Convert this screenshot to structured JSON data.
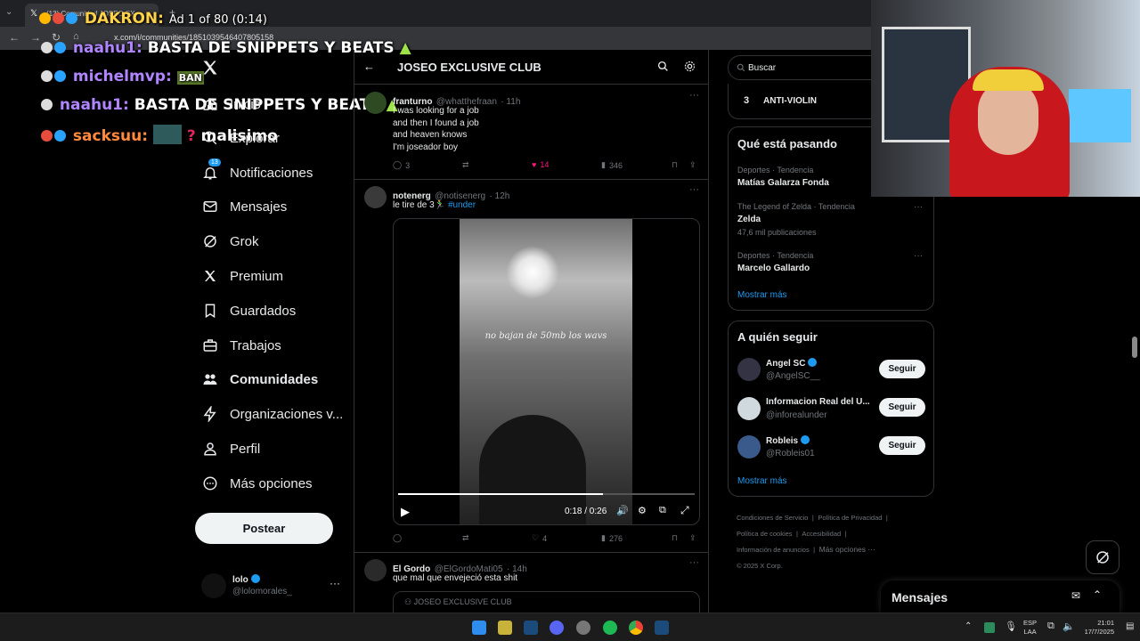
{
  "browser": {
    "tab_title": "(13) Comunidad JOSEO EX...",
    "url": "x.com/i/communities/1851039546407805158",
    "ad_text": "Ad 1 of 80 (0:14)"
  },
  "stream_overlay": {
    "streamer": "DAKRON:",
    "chat": [
      {
        "user": "naahu1:",
        "message": "BASTA DE SNIPPETS Y BEATS"
      },
      {
        "user": "michelmvp:",
        "message": "BAN"
      },
      {
        "user": "naahu1:",
        "message": "BASTA DE SNIPPETS Y BEATS"
      },
      {
        "user": "sacksuu:",
        "message": "malisimo"
      }
    ]
  },
  "nav": {
    "items": [
      {
        "label": "Inicio",
        "icon": "home-icon"
      },
      {
        "label": "Explorar",
        "icon": "search-icon"
      },
      {
        "label": "Notificaciones",
        "icon": "bell-icon",
        "badge": "13"
      },
      {
        "label": "Mensajes",
        "icon": "mail-icon"
      },
      {
        "label": "Grok",
        "icon": "grok-icon"
      },
      {
        "label": "Premium",
        "icon": "x-logo-icon"
      },
      {
        "label": "Guardados",
        "icon": "bookmark-icon"
      },
      {
        "label": "Trabajos",
        "icon": "briefcase-icon"
      },
      {
        "label": "Comunidades",
        "icon": "people-icon"
      },
      {
        "label": "Organizaciones v...",
        "icon": "bolt-icon"
      },
      {
        "label": "Perfil",
        "icon": "person-icon"
      },
      {
        "label": "Más opciones",
        "icon": "more-circle-icon"
      }
    ],
    "post_label": "Postear",
    "account": {
      "name": "lolo",
      "handle": "@lolomorales_"
    }
  },
  "community": {
    "title": "JOSEO EXCLUSIVE CLUB"
  },
  "tweets": [
    {
      "name": "franturno",
      "handle": "@whatthefraan",
      "time": "· 11h",
      "lines": [
        "I was looking for a job",
        "and then I found a job",
        "and heaven knows",
        "I'm joseador boy"
      ],
      "replies": "3",
      "likes": "14",
      "views": "346"
    },
    {
      "name": "notenerg",
      "handle": "@notisenerg",
      "time": "· 12h",
      "text": "le tire de 3🏃‍♂️",
      "hashtag": "#under",
      "video": {
        "caption": "no bajan de 50mb los wavs",
        "time": "0:18 / 0:26",
        "progress": 0.69
      },
      "likes": "4",
      "views": "276"
    },
    {
      "name": "El Gordo",
      "handle": "@ElGordoMati05",
      "time": "· 14h",
      "text": "que mal que envejeció esta shit",
      "quote_community": "JOSEO EXCLUSIVE CLUB"
    }
  ],
  "sidebar": {
    "search_placeholder": "Buscar",
    "top_item": {
      "rank": "3",
      "name": "ANTI-VIOLIN"
    },
    "trends_title": "Qué está pasando",
    "trends": [
      {
        "category": "Deportes · Tendencia",
        "name": "Matías Galarza Fonda",
        "posts": ""
      },
      {
        "category": "The Legend of Zelda · Tendencia",
        "name": "Zelda",
        "posts": "47,6 mil publicaciones"
      },
      {
        "category": "Deportes · Tendencia",
        "name": "Marcelo Gallardo",
        "posts": ""
      }
    ],
    "show_more": "Mostrar más",
    "who_to_follow_title": "A quién seguir",
    "follow": [
      {
        "name": "Angel SC",
        "handle": "@AngelSC__",
        "verified": true
      },
      {
        "name": "Informacion Real del U...",
        "handle": "@inforealunder",
        "verified": false
      },
      {
        "name": "Robleis",
        "handle": "@Robleis01",
        "verified": true
      }
    ],
    "follow_label": "Seguir",
    "footer": [
      "Condiciones de Servicio",
      "Política de Privacidad",
      "Política de cookies",
      "Accesibilidad",
      "Información de anuncios",
      "Más opciones ···",
      "© 2025 X Corp."
    ]
  },
  "messages_bar": {
    "title": "Mensajes"
  },
  "taskbar": {
    "lang": "ESP",
    "region": "LAA",
    "time": "21:01",
    "date": "17/7/2025"
  },
  "colors": {
    "accent": "#1d9bf0",
    "like": "#f91880",
    "bg": "#000000"
  }
}
